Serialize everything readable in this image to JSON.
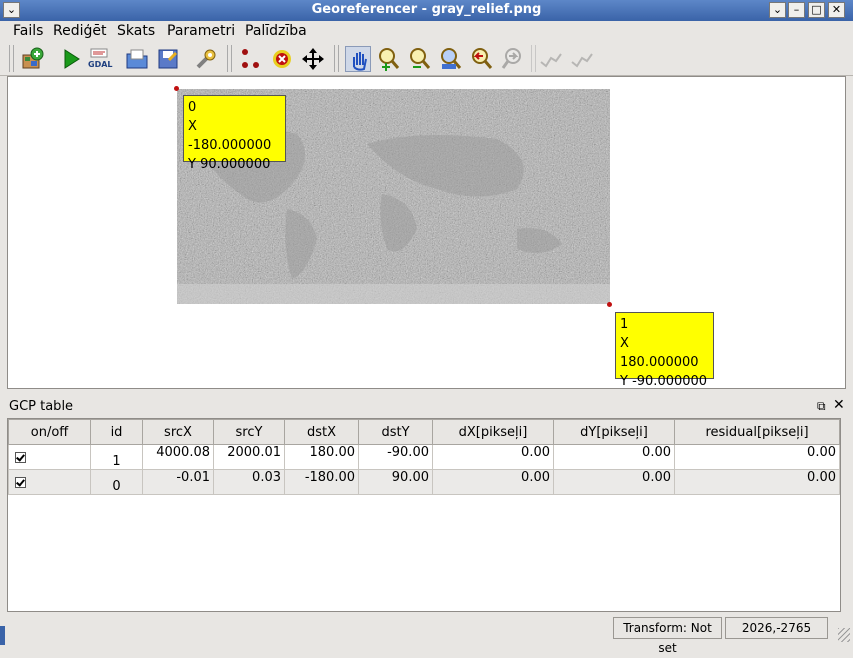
{
  "window": {
    "title": "Georeferencer - gray_relief.png"
  },
  "menu": {
    "items": [
      "Fails",
      "Rediģēt",
      "Skats",
      "Parametri",
      "Palīdzība"
    ]
  },
  "toolbar": {
    "buttons": [
      {
        "icon": "open-raster-icon"
      },
      {
        "icon": "start-georeferencing-icon"
      },
      {
        "icon": "generate-gdal-script-icon",
        "label": "GDAL"
      },
      {
        "icon": "load-gcp-icon"
      },
      {
        "icon": "save-gcp-icon"
      },
      {
        "icon": "transformation-settings-icon"
      },
      {
        "icon": "add-point-icon"
      },
      {
        "icon": "delete-point-icon"
      },
      {
        "icon": "move-point-icon"
      },
      {
        "icon": "pan-icon"
      },
      {
        "icon": "zoom-in-icon"
      },
      {
        "icon": "zoom-out-icon"
      },
      {
        "icon": "zoom-to-layer-icon"
      },
      {
        "icon": "zoom-last-icon"
      },
      {
        "icon": "zoom-next-icon"
      },
      {
        "icon": "link-georef-to-qgis-icon"
      },
      {
        "icon": "link-qgis-to-georef-icon"
      }
    ]
  },
  "canvas": {
    "gcp_labels": [
      {
        "id": "0",
        "x": "X -180.000000",
        "y": "Y 90.000000"
      },
      {
        "id": "1",
        "x": "X 180.000000",
        "y": "Y -90.000000"
      }
    ]
  },
  "dock": {
    "title": "GCP table"
  },
  "gcp_table": {
    "columns": [
      "on/off",
      "id",
      "srcX",
      "srcY",
      "dstX",
      "dstY",
      "dX[pikseļi]",
      "dY[pikseļi]",
      "residual[pikseļi]"
    ],
    "rows": [
      {
        "enabled": true,
        "cells": [
          "1",
          "4000.08",
          "2000.01",
          "180.00",
          "-90.00",
          "0.00",
          "0.00",
          "0.00"
        ]
      },
      {
        "enabled": true,
        "cells": [
          "0",
          "-0.01",
          "0.03",
          "-180.00",
          "90.00",
          "0.00",
          "0.00",
          "0.00"
        ]
      }
    ]
  },
  "status": {
    "transform": "Transform: Not set",
    "coordinates": "2026,-2765"
  }
}
